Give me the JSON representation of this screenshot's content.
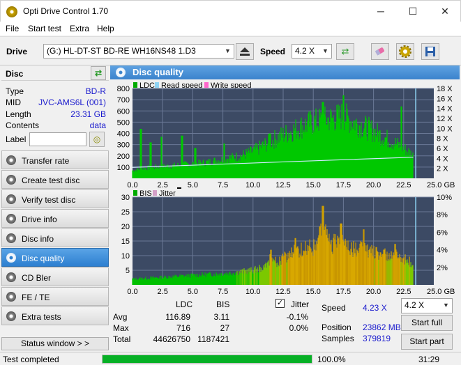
{
  "window": {
    "title": "Opti Drive Control 1.70",
    "minimize_glyph": "─",
    "maximize_glyph": "☐",
    "close_glyph": "✕"
  },
  "menu": [
    "File",
    "Start test",
    "Extra",
    "Help"
  ],
  "toolbar": {
    "drive_label": "Drive",
    "drive_value": "(G:)   HL-DT-ST BD-RE  WH16NS48 1.D3",
    "speed_label": "Speed",
    "speed_value": "4.2 X",
    "icons": [
      "eject-icon",
      "swap-icon",
      "eraser-icon",
      "gear-icon",
      "save-icon"
    ]
  },
  "disc": {
    "header": "Disc",
    "rows": [
      {
        "key": "Type",
        "value": "BD-R"
      },
      {
        "key": "MID",
        "value": "JVC-AMS6L (001)"
      },
      {
        "key": "Length",
        "value": "23.31 GB"
      },
      {
        "key": "Contents",
        "value": "data"
      }
    ],
    "label_key": "Label",
    "label_value": ""
  },
  "nav": [
    {
      "label": "Transfer rate",
      "active": false
    },
    {
      "label": "Create test disc",
      "active": false
    },
    {
      "label": "Verify test disc",
      "active": false
    },
    {
      "label": "Drive info",
      "active": false
    },
    {
      "label": "Disc info",
      "active": false
    },
    {
      "label": "Disc quality",
      "active": true
    },
    {
      "label": "CD Bler",
      "active": false
    },
    {
      "label": "FE / TE",
      "active": false
    },
    {
      "label": "Extra tests",
      "active": false
    }
  ],
  "status_window_button": "Status window > >",
  "panel_title": "Disc quality",
  "chart_data": [
    {
      "type": "area",
      "legend": [
        "LDC",
        "Read speed",
        "Write speed"
      ],
      "legend_colors": [
        "#00aa00",
        "#8fd3f4",
        "#ff66cc"
      ],
      "x_ticks": [
        "0.0",
        "2.5",
        "5.0",
        "7.5",
        "10.0",
        "12.5",
        "15.0",
        "17.5",
        "20.0",
        "22.5",
        "25.0 GB"
      ],
      "xlim": [
        0,
        25
      ],
      "y_left_ticks": [
        "100",
        "200",
        "300",
        "400",
        "500",
        "600",
        "700",
        "800"
      ],
      "ylim_left": [
        0,
        800
      ],
      "y_right_ticks": [
        "2 X",
        "4 X",
        "6 X",
        "8 X",
        "10 X",
        "12 X",
        "14 X",
        "16 X",
        "18 X"
      ],
      "ylim_right": [
        0,
        18
      ],
      "series": [
        {
          "name": "LDC",
          "x": [
            0,
            1,
            2,
            3,
            4,
            5,
            6,
            7,
            8,
            9,
            10,
            11,
            12,
            13,
            14,
            15,
            16,
            17,
            17.5,
            18,
            19,
            20,
            21,
            22,
            23,
            23.3
          ],
          "values": [
            70,
            90,
            100,
            110,
            120,
            130,
            140,
            160,
            180,
            200,
            240,
            300,
            360,
            410,
            460,
            500,
            520,
            540,
            560,
            520,
            470,
            420,
            360,
            300,
            230,
            200
          ],
          "spikes_x": [
            0.7,
            1.5,
            2.4,
            4.1,
            5.2,
            7.6,
            11.4,
            15.8,
            17.5,
            22.3
          ],
          "spikes_y": [
            440,
            320,
            370,
            380,
            270,
            310,
            400,
            680,
            740,
            640
          ]
        },
        {
          "name": "Read speed",
          "x": [
            0,
            23.3
          ],
          "values": [
            2.2,
            4.23
          ]
        }
      ],
      "marker_x": 23.5
    },
    {
      "type": "area",
      "legend": [
        "BIS",
        "Jitter"
      ],
      "legend_colors": [
        "#00aa00",
        "#d4a0c8"
      ],
      "x_ticks": [
        "0.0",
        "2.5",
        "5.0",
        "7.5",
        "10.0",
        "12.5",
        "15.0",
        "17.5",
        "20.0",
        "22.5",
        "25.0 GB"
      ],
      "xlim": [
        0,
        25
      ],
      "y_left_ticks": [
        "5",
        "10",
        "15",
        "20",
        "25",
        "30"
      ],
      "ylim_left": [
        0,
        30
      ],
      "y_right_ticks": [
        "2%",
        "4%",
        "6%",
        "8%",
        "10%"
      ],
      "ylim_right": [
        0,
        10
      ],
      "series": [
        {
          "name": "BIS",
          "x": [
            0,
            2,
            4,
            6,
            8,
            10,
            11,
            12,
            13,
            14,
            15,
            16,
            17,
            18,
            19,
            20,
            21,
            22,
            23,
            23.3
          ],
          "values": [
            2,
            2.5,
            3,
            3.5,
            4,
            5,
            6,
            8,
            10,
            12,
            13,
            14,
            14,
            13,
            12,
            11,
            10,
            9,
            8,
            6
          ],
          "peaks_x": [
            11.5,
            13.5,
            15.8,
            17.3,
            19.2,
            21.8
          ],
          "peaks_y": [
            12,
            16,
            27,
            21,
            19,
            14
          ]
        }
      ],
      "marker_x": 23.5
    }
  ],
  "stats": {
    "col_ldc": "LDC",
    "col_bis": "BIS",
    "jitter_label": "Jitter",
    "jitter_checked": "✓",
    "avg_label": "Avg",
    "max_label": "Max",
    "total_label": "Total",
    "avg_ldc": "116.89",
    "avg_bis": "3.11",
    "avg_jitter": "-0.1%",
    "max_ldc": "716",
    "max_bis": "27",
    "max_jitter": "0.0%",
    "total_ldc": "44626750",
    "total_bis": "1187421",
    "speed_label": "Speed",
    "speed_value": "4.23 X",
    "position_label": "Position",
    "position_value": "23862 MB",
    "samples_label": "Samples",
    "samples_value": "379819",
    "speed_select": "4.2 X",
    "start_full": "Start full",
    "start_part": "Start part"
  },
  "statusbar": {
    "text": "Test completed",
    "progress": 1.0,
    "progress_text": "100.0%",
    "time": "31:29"
  }
}
